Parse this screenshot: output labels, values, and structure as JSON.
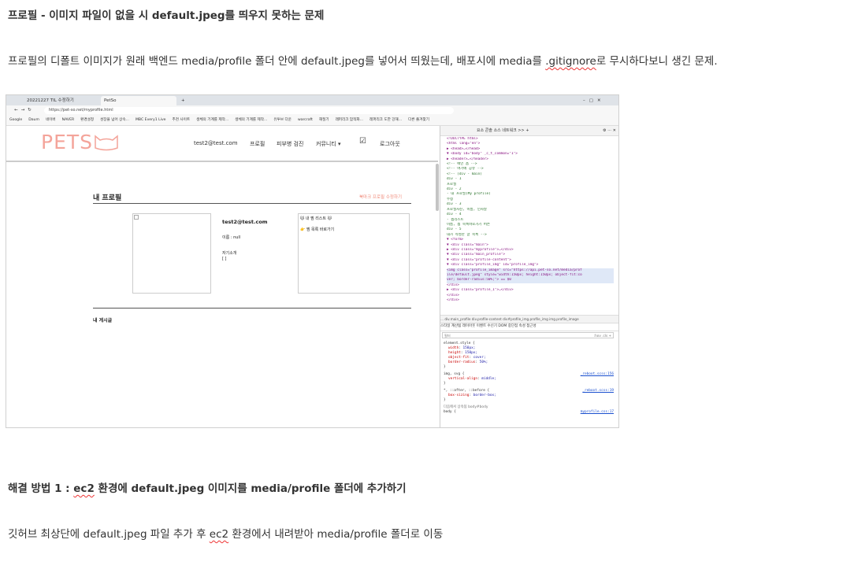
{
  "article": {
    "title": "프로필 - 이미지 파일이 없을 시 default.jpeg를 띄우지 못하는 문제",
    "para1_pre": "프로필의 디폴트 이미지가 원래 백엔드 media/profile 폴더 안에 default.jpeg를 넣어서 띄웠는데, 배포시에 media를 ",
    "para1_link": ".gitignore",
    "para1_post": "로 무시하다보니 생긴 문제.",
    "sol_title_pre": "해결 방법 1 : ",
    "sol_title_ec2": "ec2",
    "sol_title_post": " 환경에 default.jpeg 이미지를 media/profile 폴더에 추가하기",
    "para2_pre": "깃허브 최상단에 default.jpeg 파일 추가 후 ",
    "para2_ec2": "ec2",
    "para2_post": " 환경에서 내려받아 media/profile 폴더로 이동"
  },
  "screenshot": {
    "tabs": [
      "20221227 TIL 수정하기",
      "PetSo"
    ],
    "url": "https://pet-so.net/myprofile.html",
    "bookmarks": [
      "Google",
      "Daum",
      "네이버",
      "NAVER",
      "환경설정",
      "성장을 넘어 상속...",
      "MBC Every1 Live",
      "추천 사이트",
      "생체의 기계를 제작...",
      "생체의 기계를 제작...",
      "유투브 다운",
      "warcraft",
      "해질기",
      "래퍼리크 암적화...",
      "래퍼리크 도한 강해...",
      "다른 즐겨찾기"
    ],
    "site": {
      "logo": "PETS",
      "nav": [
        "test2@test.com",
        "프로필",
        "피부병 검진",
        "커뮤니티 ▾",
        "로그아웃"
      ],
      "profile_title": "내 프로필",
      "profile_edit": "북마크 프로필 수정하기",
      "email": "test2@test.com",
      "name_line": "이름 : null",
      "intro_label": "자기소개",
      "intro_value": "[ ]",
      "wish_title": "내 찜 리스트",
      "wish_item": "찜 목록 바로가기",
      "posts_title": "내 게시글"
    },
    "devtools": {
      "tabs": "요소  콘솔  소스  네트워크  >>  +",
      "dom_lines": [
        "<!DOCTYPE html>",
        "<html lang=\"en\">",
        "▶ <head>…</head>",
        "▼ <body id=\"body\" _c_t_common=\"1\">",
        "  ▶ <header>…</header>",
        "    <!-- 메인 폼 -->",
        "    <!-- 여기에 공유 -->",
        "    <!-- (div - main)",
        "    div - 1",
        "      프로필",
        "    div - 2",
        "    - 내 프로필(My profile)",
        "      수정",
        "    div - 3",
        "      프로필사진, 이름, 인사말",
        "    div - 4",
        "    - 찜리스트",
        "      이름, 찜 목록바로가기 버튼",
        "    div - 5",
        "      내가 작성한 글 목록 -->",
        "  ▼ <form>",
        "    ▼ <div class=\"main\">",
        "      ▶ <div class=\"myprofile\">…</div>",
        "      ▼ <div class=\"main_profile\">",
        "        ▼ <div class=\"profile-content\">",
        "          ▼ <div class=\"profile_img\" id=\"profile_img\">",
        "              <img class=\"profile_image\" src=\"https://api.pet-so.net/media/prof",
        "              ile/default.jpeg\" style=\"width:150px; height:150px; object-fit:co",
        "              ver; border-radius:50%;\"> == $0",
        "            </div>",
        "          ▶ <div class=\"profile_1\">…</div>",
        "          </div>",
        "        </div>"
      ],
      "crumbs": "... div.main_profile  div.profile-content  div#profile_img.profile_img  img.profile_image",
      "style_tabs": "스타일   계산됨   레이아웃   이벤트 수신기   DOM 중단점   속성   접근성",
      "filter": "필터",
      "filter_tools": ":hov  .cls  +",
      "element_style": "element.style {",
      "css_props": [
        [
          "width",
          "150px;"
        ],
        [
          "height",
          "150px;"
        ],
        [
          "object-fit",
          "cover;"
        ],
        [
          "border-radius",
          "50%;"
        ]
      ],
      "rule2": "img, svg {",
      "rule2_link": "_reboot.scss:156",
      "rule2_prop": [
        "vertical-align",
        "middle;"
      ],
      "rule3": "*, ::after, ::before {",
      "rule3_link": "_reboot.scss:19",
      "rule3_prop": [
        "box-sizing",
        "border-box;"
      ],
      "inherit": "다음에서 상속됨 body#body",
      "last": "body {",
      "last_link": "myprofile.css:17"
    }
  },
  "icon_colors": {
    "logo": "#f4a49a",
    "accent": "#f08a7a"
  }
}
